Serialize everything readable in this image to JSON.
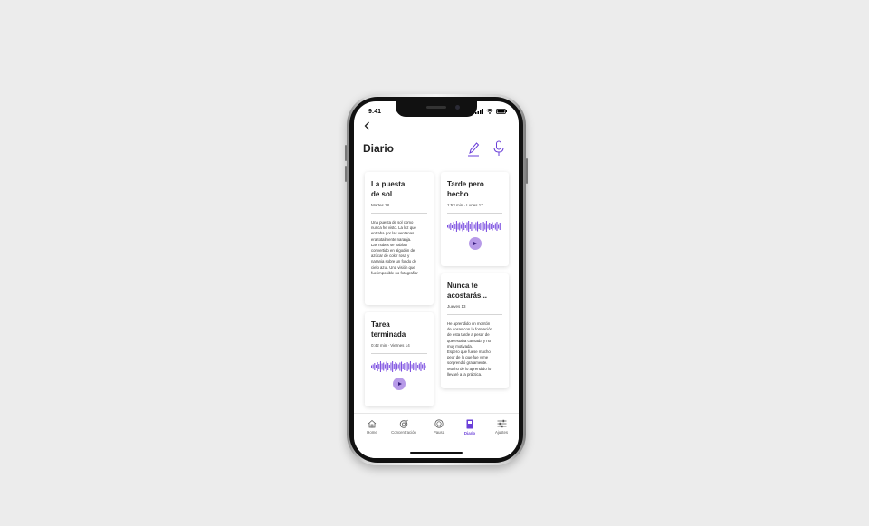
{
  "status": {
    "time": "9:41"
  },
  "header": {
    "title": "Diario",
    "back_icon": "chevron-left-icon",
    "edit_icon": "pencil-icon",
    "mic_icon": "microphone-icon"
  },
  "colors": {
    "accent": "#6a3fd8",
    "play_bg": "#b79ae8",
    "wave": "#7b4ee0",
    "background": "#ececec"
  },
  "entries": [
    {
      "title": "La puesta\nde sol",
      "meta": "Martes 18",
      "type": "text",
      "body": "Una puesta de sol como\nnunca he visto. La luz que\nentraba por las ventanas\nera totalmente naranja.\nLas nubes se habían\nconvertido en algodón de\nazúcar de color rosa y\nnaranja sobre un fondo de\ncielo azul. Una visión que\nfue imposible no fotografiar"
    },
    {
      "title": "Tarde pero\nhecho",
      "meta": "1:53 min · Lunes 17",
      "type": "audio"
    },
    {
      "title": "Tarea\nterminada",
      "meta": "0:42 min · Viernes 14",
      "type": "audio"
    },
    {
      "title": "Nunca te\nacostarás...",
      "meta": "Jueves 13",
      "type": "text",
      "body": "He aprendido un montón\nde cosas con la formación\nde esta tarde a pesar de\nque estaba cansada y no\nmuy motivada.\nEspero que fuese mucho\npeor de lo que fue y me\nsorprendió gratamente.\nMucho de lo aprendido lo\nllevaré a la práctica."
    }
  ],
  "tabs": [
    {
      "label": "Home",
      "icon": "house-icon",
      "active": false
    },
    {
      "label": "Concentración",
      "icon": "focus-icon",
      "active": false
    },
    {
      "label": "Pausa",
      "icon": "pause-circle-icon",
      "active": false
    },
    {
      "label": "Diario",
      "icon": "journal-icon",
      "active": true
    },
    {
      "label": "Ajustes",
      "icon": "sliders-icon",
      "active": false
    }
  ]
}
